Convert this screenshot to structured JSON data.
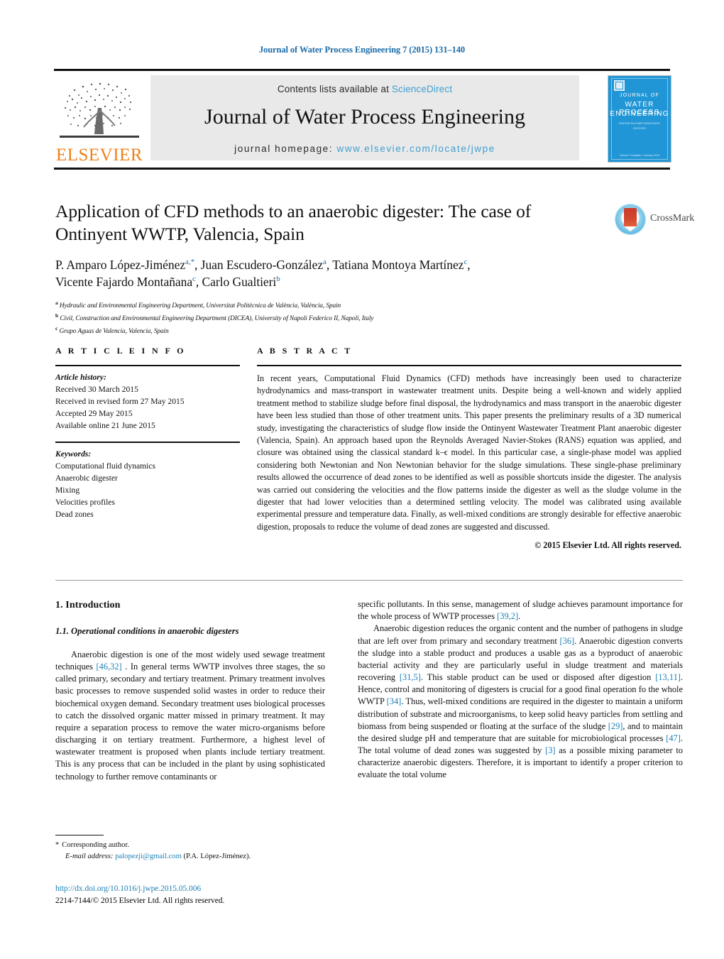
{
  "running_head": "Journal of Water Process Engineering 7 (2015) 131–140",
  "masthead": {
    "publisher_name": "ELSEVIER",
    "contents_prefix": "Contents lists available at ",
    "contents_link": "ScienceDirect",
    "journal_title": "Journal of Water Process Engineering",
    "homepage_label": "journal homepage: ",
    "homepage_url": "www.elsevier.com/locate/jwpe",
    "cover": {
      "line1": "JOURNAL OF",
      "line2": "WATER PROCESS",
      "line3": "ENGINEERING",
      "sub1": "ISSN",
      "sub2": "EDITOR-IN-CHIEF    ASSOCIATE EDITORS",
      "bottom": "Volume 7   Available 1 January 2015"
    }
  },
  "article": {
    "title": "Application of CFD methods to an anaerobic digester: The case of Ontinyent WWTP, Valencia, Spain",
    "authors_line1_pre": "P. Amparo López-Jiménez",
    "authors_mark1": "a,*",
    "authors_line1_mid": ", Juan Escudero-González",
    "authors_mark2": "a",
    "authors_line1_mid2": ", Tatiana Montoya Martínez",
    "authors_mark3": "c",
    "authors_line1_end": ",",
    "authors_line2_pre": "Vicente Fajardo Montañana",
    "authors_mark4": "c",
    "authors_line2_mid": ", Carlo Gualtieri",
    "authors_mark5": "b",
    "affiliations": [
      {
        "mark": "a",
        "text": "Hydraulic and Environmental Engineering Department, Universitat Politècnica de València, València, Spain"
      },
      {
        "mark": "b",
        "text": "Civil, Construction and Environmental Engineering Department (DICEA), University of Napoli Federico II, Napoli, Italy"
      },
      {
        "mark": "c",
        "text": "Grupo Aguas de Valencia, Valencia, Spain"
      }
    ],
    "crossmark_label": "CrossMark"
  },
  "article_info": {
    "heading": "A R T I C L E   I N F O",
    "history_label": "Article history:",
    "history": [
      "Received 30 March 2015",
      "Received in revised form 27 May 2015",
      "Accepted 29 May 2015",
      "Available online 21 June 2015"
    ],
    "keywords_label": "Keywords:",
    "keywords": [
      "Computational fluid dynamics",
      "Anaerobic digester",
      "Mixing",
      "Velocities profiles",
      "Dead zones"
    ]
  },
  "abstract": {
    "heading": "A B S T R A C T",
    "text": "In recent years, Computational Fluid Dynamics (CFD) methods have increasingly been used to characterize hydrodynamics and mass-transport in wastewater treatment units. Despite being a well-known and widely applied treatment method to stabilize sludge before final disposal, the hydrodynamics and mass transport in the anaerobic digester have been less studied than those of other treatment units. This paper presents the preliminary results of a 3D numerical study, investigating the characteristics of sludge flow inside the Ontinyent Wastewater Treatment Plant anaerobic digester (Valencia, Spain). An approach based upon the Reynolds Averaged Navier-Stokes (RANS) equation was applied, and closure was obtained using the classical standard k–ϵ model. In this particular case, a single-phase model was applied considering both Newtonian and Non Newtonian behavior for the sludge simulations. These single-phase preliminary results allowed the occurrence of dead zones to be identified as well as possible shortcuts inside the digester. The analysis was carried out considering the velocities and the flow patterns inside the digester as well as the sludge volume in the digester that had lower velocities than a determined settling velocity. The model was calibrated using available experimental pressure and temperature data. Finally, as well-mixed conditions are strongly desirable for effective anaerobic digestion, proposals to reduce the volume of dead zones are suggested and discussed.",
    "copyright": "© 2015 Elsevier Ltd. All rights reserved."
  },
  "body": {
    "section_heading": "1.  Introduction",
    "subsection_heading": "1.1.  Operational conditions in anaerobic digesters",
    "left_paragraph_1_a": "Anaerobic digestion is one of the most widely used sewage treatment techniques ",
    "left_paragraph_1_ref": "[46,32]",
    "left_paragraph_1_b": " . In general terms WWTP involves three stages, the so called primary, secondary and tertiary treatment. Primary treatment involves basic processes to remove suspended solid wastes in order to reduce their biochemical oxygen demand. Secondary treatment uses biological processes to catch the dissolved organic matter missed in primary treatment. It may require a separation process to remove the water micro-organisms before discharging it on tertiary treatment. Furthermore, a highest level of wastewater treatment is proposed when plants include tertiary treatment. This is any process that can be included in the plant by using sophisticated technology to further remove contaminants or",
    "right_p1_a": "specific pollutants. In this sense, management of sludge achieves paramount importance for the whole process of WWTP processes ",
    "right_p1_ref": "[39,2]",
    "right_p1_b": ".",
    "right_p2_a": "Anaerobic digestion reduces the organic content and the number of pathogens in sludge that are left over from primary and secondary treatment ",
    "right_p2_ref1": "[36]",
    "right_p2_b": ". Anaerobic digestion converts the sludge into a stable product and produces a usable gas as a byproduct of anaerobic bacterial activity and they are particularly useful in sludge treatment and materials recovering ",
    "right_p2_ref2": "[31,5]",
    "right_p2_c": ". This stable product can be used or disposed after digestion ",
    "right_p2_ref3": "[13,11]",
    "right_p2_d": ". Hence, control and monitoring of digesters is crucial for a good final operation fo the whole WWTP ",
    "right_p2_ref4": "[34]",
    "right_p2_e": ". Thus, well-mixed conditions are required in the digester to maintain a uniform distribution of substrate and microorganisms, to keep solid heavy particles from settling and biomass from being suspended or floating at the surface of the sludge ",
    "right_p2_ref5": "[29]",
    "right_p2_f": ", and to maintain the desired sludge pH and temperature that are suitable for microbiological processes ",
    "right_p2_ref6": "[47]",
    "right_p2_g": ". The total volume of dead zones was suggested by ",
    "right_p2_ref7": "[3]",
    "right_p2_h": " as a possible mixing parameter to characterize anaerobic digesters. Therefore, it is important to identify a proper criterion to evaluate the total volume"
  },
  "footer": {
    "corresponding_star": "*",
    "corresponding_label": "Corresponding author.",
    "email_label": "E-mail address:",
    "email": "palopezji@gmail.com",
    "email_owner": "(P.A. López-Jiménez).",
    "doi": "http://dx.doi.org/10.1016/j.jwpe.2015.05.006",
    "issn_line": "2214-7144/© 2015 Elsevier Ltd. All rights reserved."
  },
  "colors": {
    "link_blue": "#1b7fb5",
    "header_blue": "#1b6ca8",
    "elsevier_orange": "#f08019",
    "cover_blue": "#2196d6",
    "sciencedirect_blue": "#3f9fd0"
  }
}
